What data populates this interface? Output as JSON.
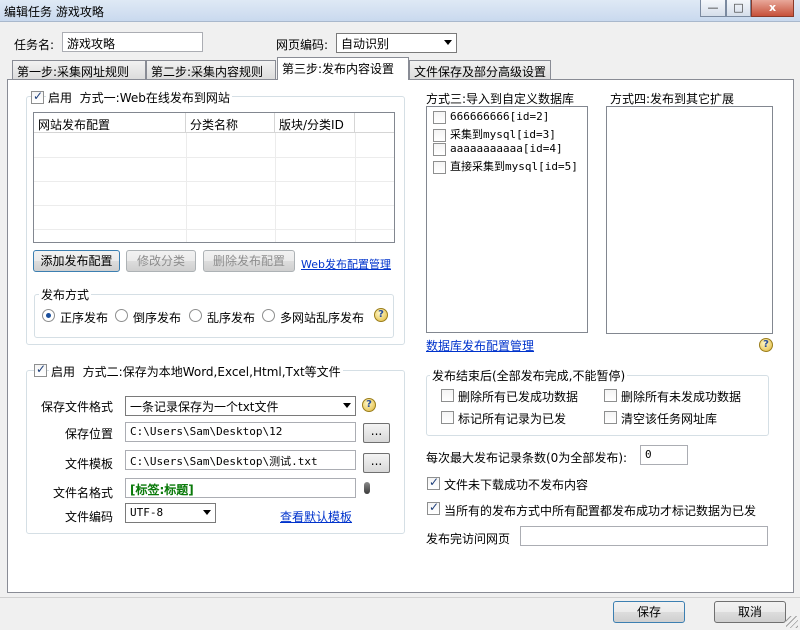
{
  "window": {
    "title": "编辑任务 游戏攻略",
    "min_label": "—",
    "max_label": "□",
    "close_label": "x"
  },
  "header": {
    "task_name_label": "任务名:",
    "task_name_value": "游戏攻略",
    "encoding_label": "网页编码:",
    "encoding_value": "自动识别"
  },
  "tabs": [
    {
      "label": "第一步:采集网址规则"
    },
    {
      "label": "第二步:采集内容规则"
    },
    {
      "label": "第三步:发布内容设置"
    },
    {
      "label": "文件保存及部分高级设置"
    }
  ],
  "method1": {
    "enable_label": "启用",
    "title": "方式一:Web在线发布到网站",
    "columns": [
      "网站发布配置",
      "分类名称",
      "版块/分类ID"
    ],
    "add_button": "添加发布配置",
    "edit_button": "修改分类",
    "delete_button": "删除发布配置",
    "manage_link": "Web发布配置管理",
    "publish_group_title": "发布方式",
    "radio_options": [
      "正序发布",
      "倒序发布",
      "乱序发布",
      "多网站乱序发布"
    ]
  },
  "method3": {
    "title": "方式三:导入到自定义数据库",
    "items": [
      "666666666[id=2]",
      "采集到mysql[id=3]",
      "aaaaaaaaaaa[id=4]",
      "直接采集到mysql[id=5]"
    ],
    "manage_link": "数据库发布配置管理"
  },
  "method4": {
    "title": "方式四:发布到其它扩展"
  },
  "method2": {
    "enable_label": "启用",
    "title": "方式二:保存为本地Word,Excel,Html,Txt等文件",
    "format_label": "保存文件格式",
    "format_value": "一条记录保存为一个txt文件",
    "location_label": "保存位置",
    "location_value": "C:\\Users\\Sam\\Desktop\\12",
    "template_label": "文件模板",
    "template_value": "C:\\Users\\Sam\\Desktop\\测试.txt",
    "filename_label": "文件名格式",
    "filename_value": "[标签:标题]",
    "encoding_label": "文件编码",
    "encoding_value": "UTF-8",
    "view_template_link": "查看默认模板",
    "browse_label": "..."
  },
  "after_publish": {
    "title": "发布结束后(全部发布完成,不能暂停)",
    "options": [
      "删除所有已发成功数据",
      "删除所有未发成功数据",
      "标记所有记录为已发",
      "清空该任务网址库"
    ]
  },
  "settings": {
    "max_records_label": "每次最大发布记录条数(0为全部发布):",
    "max_records_value": "0",
    "no_publish_label": "文件未下载成功不发布内容",
    "mark_label": "当所有的发布方式中所有配置都发布成功才标记数据为已发",
    "visit_label": "发布完访问网页",
    "visit_value": ""
  },
  "footer": {
    "save_button": "保存",
    "cancel_button": "取消"
  },
  "colors": {
    "link": "#0033cc",
    "filename_text": "#0a7a0a"
  }
}
